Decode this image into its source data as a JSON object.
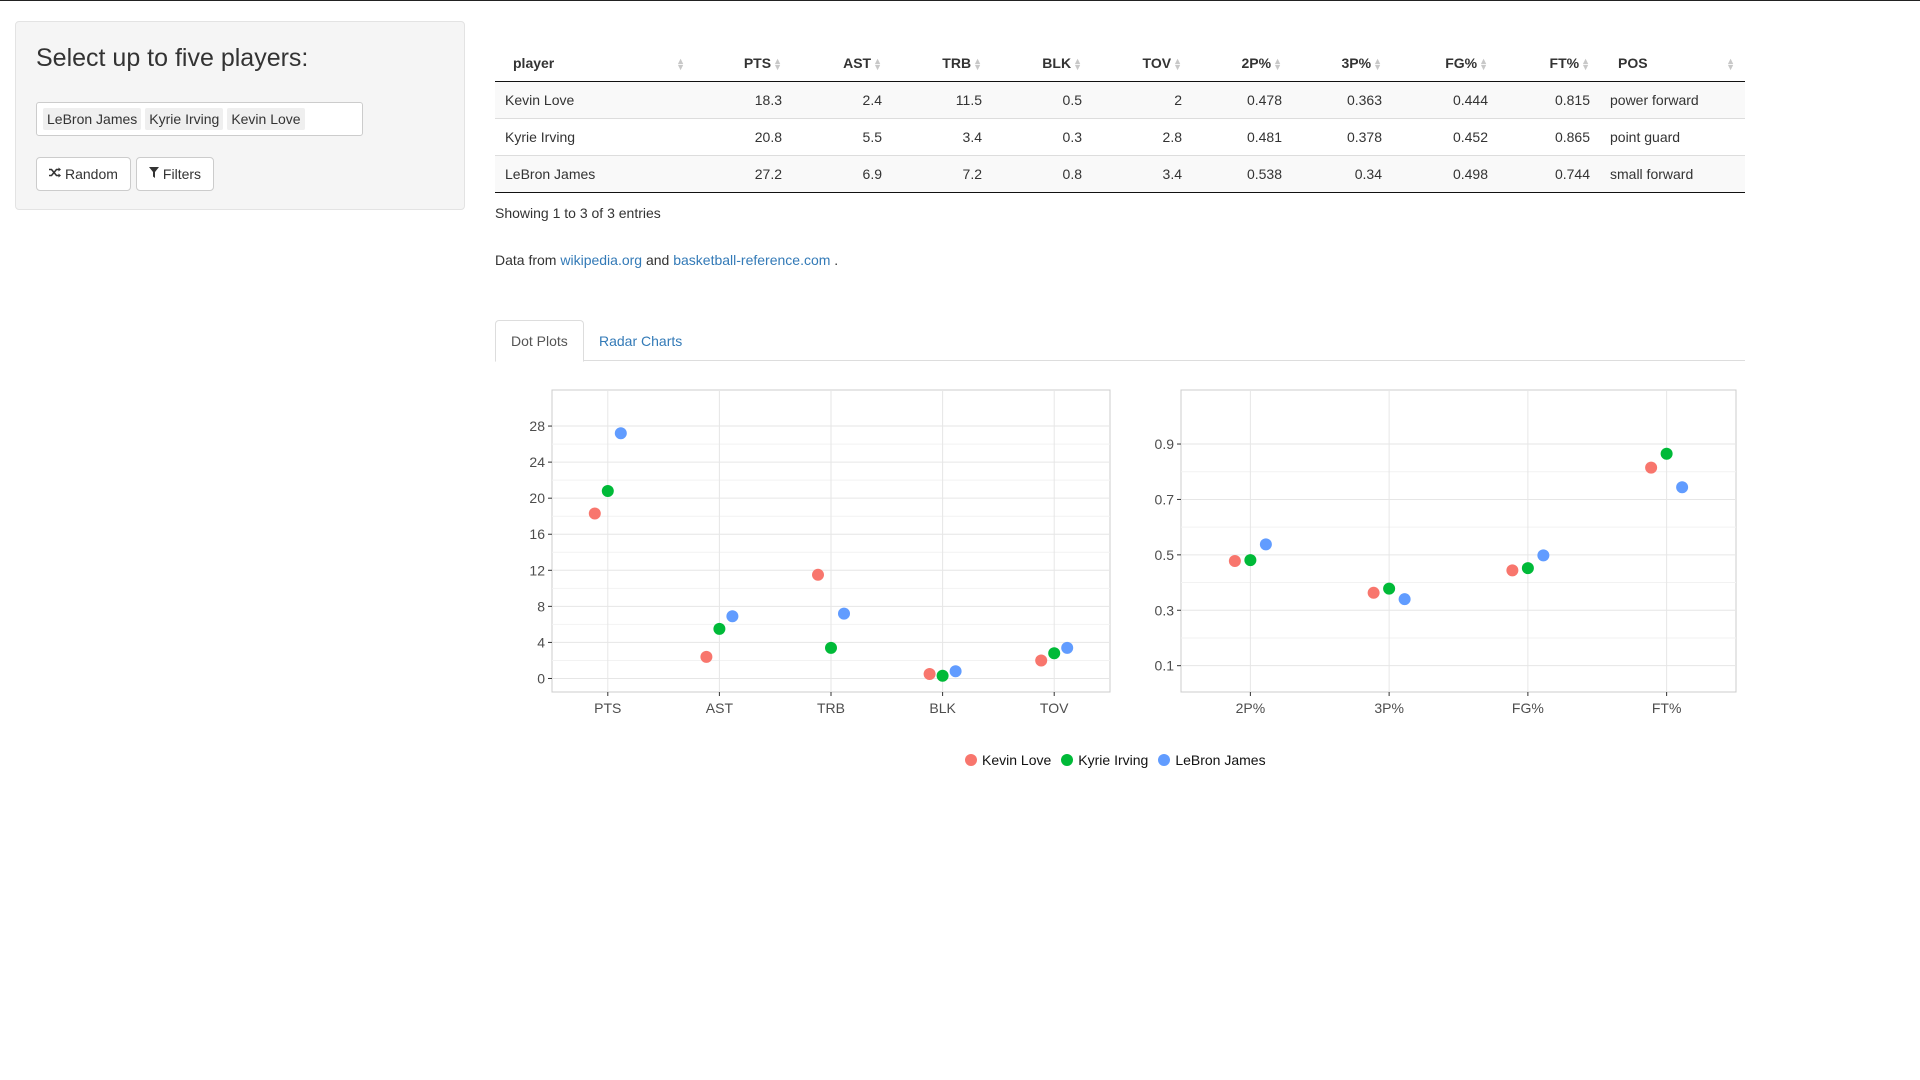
{
  "sidebar": {
    "title": "Select up to five players:",
    "selected_players": [
      "LeBron James",
      "Kyrie Irving",
      "Kevin Love"
    ],
    "random_label": "Random",
    "filters_label": "Filters",
    "random_icon": "shuffle-icon",
    "filters_icon": "filter-icon"
  },
  "table": {
    "columns": [
      "player",
      "PTS",
      "AST",
      "TRB",
      "BLK",
      "TOV",
      "2P%",
      "3P%",
      "FG%",
      "FT%",
      "POS"
    ],
    "rows": [
      [
        "Kevin Love",
        "18.3",
        "2.4",
        "11.5",
        "0.5",
        "2",
        "0.478",
        "0.363",
        "0.444",
        "0.815",
        "power forward"
      ],
      [
        "Kyrie Irving",
        "20.8",
        "5.5",
        "3.4",
        "0.3",
        "2.8",
        "0.481",
        "0.378",
        "0.452",
        "0.865",
        "point guard"
      ],
      [
        "LeBron James",
        "27.2",
        "6.9",
        "7.2",
        "0.8",
        "3.4",
        "0.538",
        "0.34",
        "0.498",
        "0.744",
        "small forward"
      ]
    ],
    "info": "Showing 1 to 3 of 3 entries"
  },
  "source": {
    "prefix": "Data from",
    "link1": "wikipedia.org",
    "middle": "and",
    "link2": "basketball-reference.com",
    "suffix": "."
  },
  "tabs": [
    {
      "label": "Dot Plots",
      "active": true
    },
    {
      "label": "Radar Charts",
      "active": false
    }
  ],
  "colors": {
    "Kevin Love": "#f8766d",
    "Kyrie Irving": "#00ba38",
    "LeBron James": "#619cff"
  },
  "chart_data": [
    {
      "type": "scatter",
      "categories": [
        "PTS",
        "AST",
        "TRB",
        "BLK",
        "TOV"
      ],
      "ylim": [
        -1.5,
        32
      ],
      "yticks": [
        0,
        4,
        8,
        12,
        16,
        20,
        24,
        28
      ],
      "grid": true,
      "series": [
        {
          "name": "Kevin Love",
          "values": [
            18.3,
            2.4,
            11.5,
            0.5,
            2
          ]
        },
        {
          "name": "Kyrie Irving",
          "values": [
            20.8,
            5.5,
            3.4,
            0.3,
            2.8
          ]
        },
        {
          "name": "LeBron James",
          "values": [
            27.2,
            6.9,
            7.2,
            0.8,
            3.4
          ]
        }
      ]
    },
    {
      "type": "scatter",
      "categories": [
        "2P%",
        "3P%",
        "FG%",
        "FT%"
      ],
      "ylim": [
        0.005,
        1.095
      ],
      "yticks": [
        0.1,
        0.3,
        0.5,
        0.7,
        0.9
      ],
      "yticklabels": [
        "0.1",
        "0.3",
        "0.5",
        "0.7",
        "0.9"
      ],
      "grid": true,
      "series": [
        {
          "name": "Kevin Love",
          "values": [
            0.478,
            0.363,
            0.444,
            0.815
          ]
        },
        {
          "name": "Kyrie Irving",
          "values": [
            0.481,
            0.378,
            0.452,
            0.865
          ]
        },
        {
          "name": "LeBron James",
          "values": [
            0.538,
            0.34,
            0.498,
            0.744
          ]
        }
      ]
    }
  ],
  "legend": {
    "position": "bottom",
    "entries": [
      "Kevin Love",
      "Kyrie Irving",
      "LeBron James"
    ]
  }
}
